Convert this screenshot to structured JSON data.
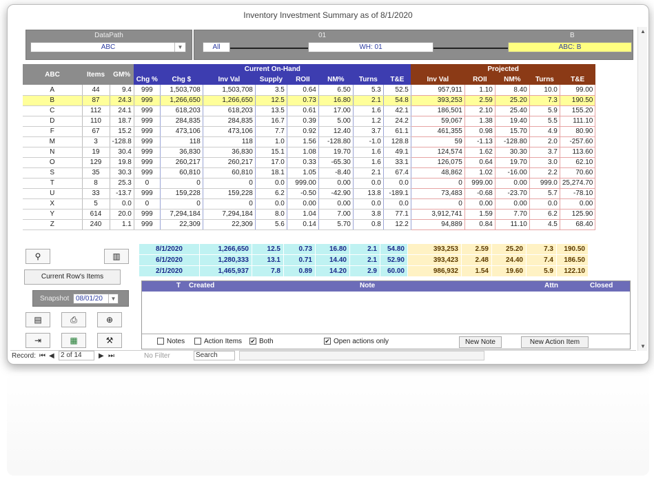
{
  "window": {
    "title": "Inventory Investment Summary as of 8/1/2020"
  },
  "datapath": {
    "label": "DataPath",
    "value": "ABC"
  },
  "hierarchy": {
    "level1_label": "01",
    "level2_label": "B",
    "node_all": "All",
    "node_wh": "WH: 01",
    "node_abc": "ABC: B"
  },
  "grid": {
    "group_current": "Current On-Hand",
    "group_projected": "Projected",
    "col_abc": "ABC",
    "col_items": "Items",
    "col_gm": "GM%",
    "cur_cols": [
      "Chg %",
      "Chg $",
      "Inv Val",
      "Supply",
      "ROII",
      "NM%",
      "Turns",
      "T&E"
    ],
    "prj_cols": [
      "Inv Val",
      "ROII",
      "NM%",
      "Turns",
      "T&E"
    ],
    "rows": [
      [
        "A",
        "44",
        "9.4",
        "999",
        "1,503,708",
        "1,503,708",
        "3.5",
        "0.64",
        "6.50",
        "5.3",
        "52.5",
        "957,911",
        "1.10",
        "8.40",
        "10.0",
        "99.00"
      ],
      [
        "B",
        "87",
        "24.3",
        "999",
        "1,266,650",
        "1,266,650",
        "12.5",
        "0.73",
        "16.80",
        "2.1",
        "54.8",
        "393,253",
        "2.59",
        "25.20",
        "7.3",
        "190.50"
      ],
      [
        "C",
        "112",
        "24.1",
        "999",
        "618,203",
        "618,203",
        "13.5",
        "0.61",
        "17.00",
        "1.6",
        "42.1",
        "186,501",
        "2.10",
        "25.40",
        "5.9",
        "155.20"
      ],
      [
        "D",
        "110",
        "18.7",
        "999",
        "284,835",
        "284,835",
        "16.7",
        "0.39",
        "5.00",
        "1.2",
        "24.2",
        "59,067",
        "1.38",
        "19.40",
        "5.5",
        "111.10"
      ],
      [
        "F",
        "67",
        "15.2",
        "999",
        "473,106",
        "473,106",
        "7.7",
        "0.92",
        "12.40",
        "3.7",
        "61.1",
        "461,355",
        "0.98",
        "15.70",
        "4.9",
        "80.90"
      ],
      [
        "M",
        "3",
        "-128.8",
        "999",
        "118",
        "118",
        "1.0",
        "1.56",
        "-128.80",
        "-1.0",
        "128.8",
        "59",
        "-1.13",
        "-128.80",
        "2.0",
        "-257.60"
      ],
      [
        "N",
        "19",
        "30.4",
        "999",
        "36,830",
        "36,830",
        "15.1",
        "1.08",
        "19.70",
        "1.6",
        "49.1",
        "124,574",
        "1.62",
        "30.30",
        "3.7",
        "113.60"
      ],
      [
        "O",
        "129",
        "19.8",
        "999",
        "260,217",
        "260,217",
        "17.0",
        "0.33",
        "-65.30",
        "1.6",
        "33.1",
        "126,075",
        "0.64",
        "19.70",
        "3.0",
        "62.10"
      ],
      [
        "S",
        "35",
        "30.3",
        "999",
        "60,810",
        "60,810",
        "18.1",
        "1.05",
        "-8.40",
        "2.1",
        "67.4",
        "48,862",
        "1.02",
        "-16.00",
        "2.2",
        "70.60"
      ],
      [
        "T",
        "8",
        "25.3",
        "0",
        "0",
        "0",
        "0.0",
        "999.00",
        "0.00",
        "0.0",
        "0.0",
        "0",
        "999.00",
        "0.00",
        "999.0",
        "25,274.70"
      ],
      [
        "U",
        "33",
        "-13.7",
        "999",
        "159,228",
        "159,228",
        "6.2",
        "-0.50",
        "-42.90",
        "13.8",
        "-189.1",
        "73,483",
        "-0.68",
        "-23.70",
        "5.7",
        "-78.10"
      ],
      [
        "X",
        "5",
        "0.0",
        "0",
        "0",
        "0",
        "0.0",
        "0.00",
        "0.00",
        "0.0",
        "0.0",
        "0",
        "0.00",
        "0.00",
        "0.0",
        "0.00"
      ],
      [
        "Y",
        "614",
        "20.0",
        "999",
        "7,294,184",
        "7,294,184",
        "8.0",
        "1.04",
        "7.00",
        "3.8",
        "77.1",
        "3,912,741",
        "1.59",
        "7.70",
        "6.2",
        "125.90"
      ],
      [
        "Z",
        "240",
        "1.1",
        "999",
        "22,309",
        "22,309",
        "5.6",
        "0.14",
        "5.70",
        "0.8",
        "12.2",
        "94,889",
        "0.84",
        "11.10",
        "4.5",
        "68.40"
      ]
    ]
  },
  "summary": [
    [
      "8/1/2020",
      "1,266,650",
      "12.5",
      "0.73",
      "16.80",
      "2.1",
      "54.80",
      "393,253",
      "2.59",
      "25.20",
      "7.3",
      "190.50"
    ],
    [
      "6/1/2020",
      "1,280,333",
      "13.1",
      "0.71",
      "14.40",
      "2.1",
      "52.90",
      "393,423",
      "2.48",
      "24.40",
      "7.4",
      "186.50"
    ],
    [
      "2/1/2020",
      "1,465,937",
      "7.8",
      "0.89",
      "14.20",
      "2.9",
      "60.00",
      "986,932",
      "1.54",
      "19.60",
      "5.9",
      "122.10"
    ]
  ],
  "left_panel": {
    "current_rows_label": "Current Row's Items",
    "snapshot_label": "Snapshot",
    "snapshot_value": "08/01/20"
  },
  "notes": {
    "col_t": "T",
    "col_created": "Created",
    "col_note": "Note",
    "col_attn": "Attn",
    "col_closed": "Closed",
    "chk_notes": "Notes",
    "chk_action": "Action Items",
    "chk_both": "Both",
    "chk_open": "Open actions only",
    "new_note": "New Note",
    "new_action": "New Action Item"
  },
  "status": {
    "record_label": "Record:",
    "record_pos": "2 of 14",
    "no_filter": "No Filter",
    "search": "Search"
  },
  "colors": {
    "current_header": "#3d3db0",
    "projected_header": "#8b3a16",
    "selected_row": "#ffff9a"
  }
}
